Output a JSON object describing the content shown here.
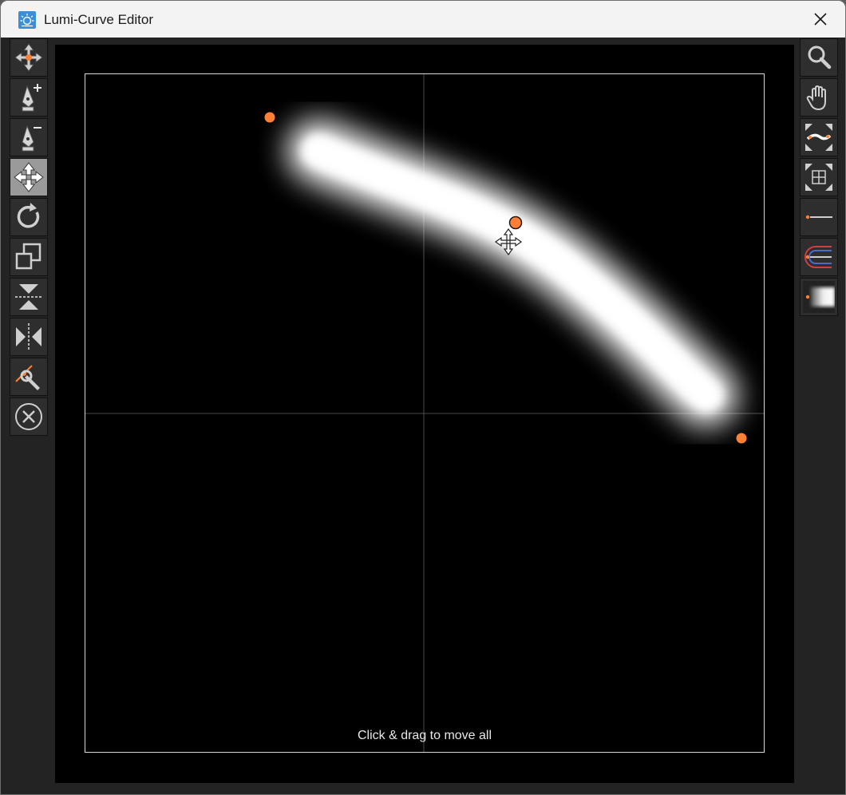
{
  "window": {
    "title": "Lumi-Curve Editor"
  },
  "toolbar_left": [
    {
      "name": "move-point-tool-button",
      "icon": "move-point-icon",
      "active": false
    },
    {
      "name": "add-point-tool-button",
      "icon": "pen-plus-icon",
      "active": false
    },
    {
      "name": "remove-point-tool-button",
      "icon": "pen-minus-icon",
      "active": false
    },
    {
      "name": "move-all-tool-button",
      "icon": "move-all-icon",
      "active": true
    },
    {
      "name": "rotate-tool-button",
      "icon": "rotate-icon",
      "active": false
    },
    {
      "name": "scale-tool-button",
      "icon": "scale-icon",
      "active": false
    },
    {
      "name": "flip-vertical-button",
      "icon": "flip-vertical-icon",
      "active": false
    },
    {
      "name": "flip-horizontal-button",
      "icon": "flip-horizontal-icon",
      "active": false
    },
    {
      "name": "edit-tangent-button",
      "icon": "tangent-wrench-icon",
      "active": false
    },
    {
      "name": "reset-button",
      "icon": "circle-x-icon",
      "active": false
    }
  ],
  "toolbar_right": [
    {
      "name": "zoom-tool-button",
      "icon": "magnifier-icon"
    },
    {
      "name": "pan-tool-button",
      "icon": "hand-icon"
    },
    {
      "name": "fit-curve-button",
      "icon": "fit-curve-icon"
    },
    {
      "name": "fit-grid-button",
      "icon": "fit-grid-icon"
    },
    {
      "name": "line-width-button",
      "icon": "thin-line-icon"
    },
    {
      "name": "gradient-stroke-button",
      "icon": "gradient-arc-icon"
    },
    {
      "name": "soft-glow-button",
      "icon": "glow-brush-icon"
    }
  ],
  "canvas": {
    "hint": "Click & drag to move all",
    "accent_color": "#ff8035",
    "curve_color": "#ffffff"
  }
}
